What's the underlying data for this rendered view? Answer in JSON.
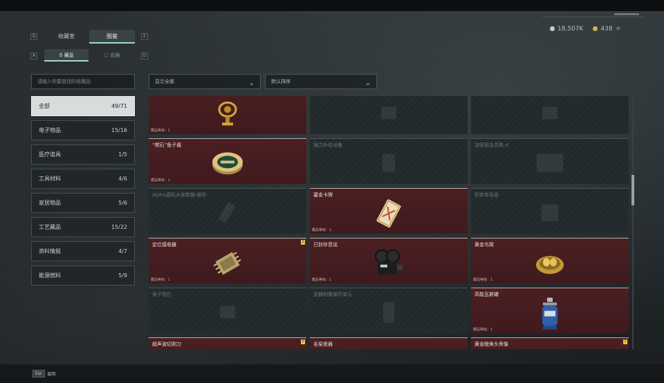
{
  "currency": {
    "silver_value": "18,507K",
    "gold_value": "438",
    "add_label": "+"
  },
  "tabs": {
    "prev_key": "Q",
    "next_key": "E",
    "items": [
      {
        "label": "收藏室",
        "active": false
      },
      {
        "label": "图鉴",
        "active": true
      }
    ]
  },
  "subtabs": {
    "prev_key": "A",
    "next_key": "D",
    "items": [
      {
        "label": "藏品",
        "active": true
      },
      {
        "label": "武器",
        "active": false
      }
    ]
  },
  "search": {
    "placeholder": "请输入你要查找的收藏品"
  },
  "filters": {
    "show": "显示全部",
    "sort": "默认排序"
  },
  "categories": [
    {
      "label": "全部",
      "count": "49/71",
      "active": true
    },
    {
      "label": "电子物品",
      "count": "15/16"
    },
    {
      "label": "医疗道具",
      "count": "1/5"
    },
    {
      "label": "工具材料",
      "count": "4/6"
    },
    {
      "label": "家居物品",
      "count": "5/6"
    },
    {
      "label": "工艺藏品",
      "count": "15/22"
    },
    {
      "label": "资料情报",
      "count": "4/7"
    },
    {
      "label": "能源燃料",
      "count": "5/9"
    }
  ],
  "cards": [
    {
      "name": "",
      "owned": true,
      "tag": "藏品等级：1",
      "icon": "trophy-icon"
    },
    {
      "name": "",
      "owned": false,
      "icon": "device-icon"
    },
    {
      "name": "",
      "owned": false,
      "icon": "device-icon"
    },
    {
      "name": "“燃石”鱼子酱",
      "owned": true,
      "tag": "藏品等级：1",
      "icon": "caviar-tin-icon"
    },
    {
      "name": "强力补给设备",
      "owned": false,
      "icon": "supply-device-icon"
    },
    {
      "name": "加密狙击范数-4",
      "owned": false,
      "icon": "crate-icon"
    },
    {
      "name": "Alpha漏机水准数据-缓存",
      "owned": false,
      "icon": "usb-drive-icon"
    },
    {
      "name": "鎏金卡牌",
      "owned": true,
      "tag": "藏品等级：1",
      "icon": "gold-card-icon"
    },
    {
      "name": "奶茶库名画",
      "owned": false,
      "icon": "painting-icon"
    },
    {
      "name": "定位接收器",
      "owned": true,
      "tag": "藏品等级：1",
      "badge": "!",
      "icon": "receiver-icon"
    },
    {
      "name": "已封存音谈",
      "owned": true,
      "tag": "藏品等级：1",
      "icon": "film-projector-icon"
    },
    {
      "name": "黄金鸟窝",
      "owned": true,
      "tag": "藏品等级：1",
      "icon": "golden-nest-icon"
    },
    {
      "name": "电子阻拦",
      "owned": false,
      "icon": "device-icon"
    },
    {
      "name": "武器制备弹药单元",
      "owned": false,
      "icon": "canister-icon"
    },
    {
      "name": "高能瓦斯罐",
      "owned": true,
      "tag": "藏品等级：1",
      "icon": "gas-canister-icon"
    },
    {
      "name": "超声波切割刀",
      "owned": true,
      "tag": "藏品等级：1",
      "badge": "!",
      "icon": "blade-icon"
    },
    {
      "name": "名窑瓷器",
      "owned": true,
      "tag": "藏品等级：1",
      "icon": "chess-piece-icon"
    },
    {
      "name": "黄金瞪角头骨像",
      "owned": true,
      "tag": "藏品等级：1",
      "badge": "!",
      "icon": "gold-skull-icon"
    }
  ],
  "footer": {
    "esc_key": "Esc",
    "esc_label": "返回"
  }
}
